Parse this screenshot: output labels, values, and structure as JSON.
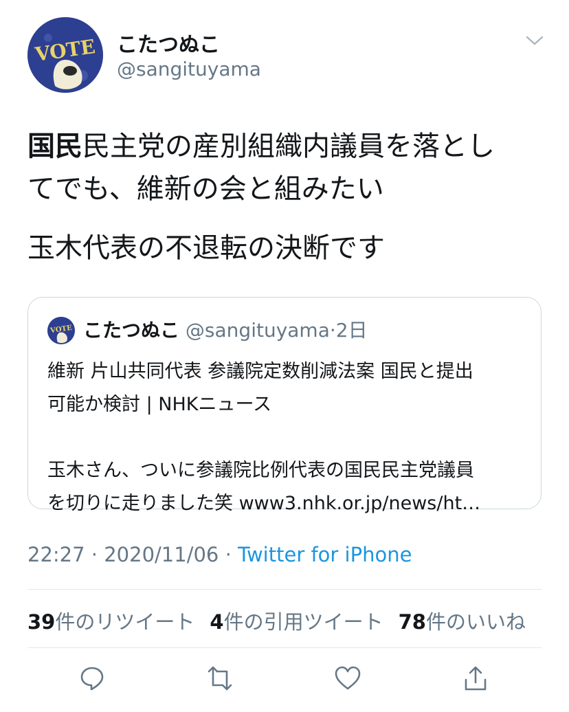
{
  "author": {
    "display_name": "こたつぬこ",
    "handle": "@sangituyama",
    "avatar_text": "VOTE"
  },
  "tweet": {
    "bold_prefix": "国民",
    "line1_rest": "民主党の産別組織内議員を落とし",
    "line2": "てでも、維新の会と組みたい",
    "line3": "玉木代表の不退転の決断です"
  },
  "quote": {
    "display_name": "こたつぬこ",
    "handle": "@sangituyama",
    "separator": "·",
    "age": "2日",
    "lines": [
      "維新 片山共同代表 参議院定数削減法案 国民と提出",
      "可能か検討 | NHKニュース",
      "玉木さん、ついに参議院比例代表の国民民主党議員",
      "を切りに走りました笑 www3.nhk.or.jp/news/ht…"
    ]
  },
  "meta": {
    "time": "22:27",
    "sep1": "·",
    "date": "2020/11/06",
    "sep2": "·",
    "source": "Twitter for iPhone"
  },
  "stats": {
    "retweets_count": "39",
    "retweets_label": "件のリツイート",
    "quotes_count": "4",
    "quotes_label": "件の引用ツイート",
    "likes_count": "78",
    "likes_label": "件のいいね"
  },
  "icons": {
    "reply": "reply-icon",
    "retweet": "retweet-icon",
    "like": "like-icon",
    "share": "share-icon",
    "caret": "chevron-down-icon"
  },
  "colors": {
    "text": "#14171a",
    "secondary": "#657786",
    "link": "#1b95e0",
    "border": "#ccd6dd"
  }
}
